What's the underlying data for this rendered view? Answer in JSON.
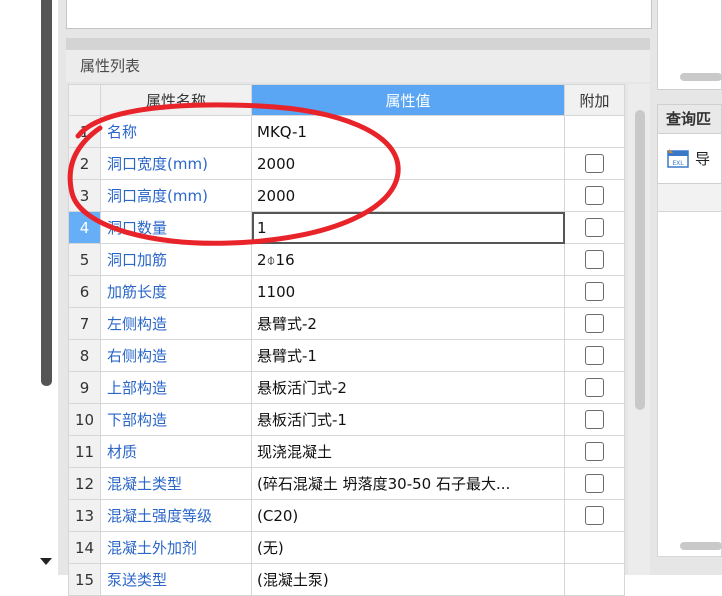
{
  "panel": {
    "title": "属性列表",
    "columns": {
      "index": "",
      "name": "属性名称",
      "value": "属性值",
      "extra": "附加"
    }
  },
  "rows": [
    {
      "index": "1",
      "name": "名称",
      "value": "MKQ-1",
      "has_checkbox": false
    },
    {
      "index": "2",
      "name": "洞口宽度(mm)",
      "value": "2000",
      "has_checkbox": true
    },
    {
      "index": "3",
      "name": "洞口高度(mm)",
      "value": "2000",
      "has_checkbox": true
    },
    {
      "index": "4",
      "name": "洞口数量",
      "value": "1",
      "has_checkbox": true,
      "selected": true
    },
    {
      "index": "5",
      "name": "洞口加筋",
      "value": "2⌽16",
      "has_checkbox": true
    },
    {
      "index": "6",
      "name": "加筋长度",
      "value": "1100",
      "has_checkbox": true
    },
    {
      "index": "7",
      "name": "左侧构造",
      "value": "悬臂式-2",
      "has_checkbox": true
    },
    {
      "index": "8",
      "name": "右侧构造",
      "value": "悬臂式-1",
      "has_checkbox": true
    },
    {
      "index": "9",
      "name": "上部构造",
      "value": "悬板活门式-2",
      "has_checkbox": true
    },
    {
      "index": "10",
      "name": "下部构造",
      "value": "悬板活门式-1",
      "has_checkbox": true
    },
    {
      "index": "11",
      "name": "材质",
      "value": "现浇混凝土",
      "has_checkbox": true
    },
    {
      "index": "12",
      "name": "混凝土类型",
      "value": "(碎石混凝土 坍落度30-50 石子最大...",
      "has_checkbox": true
    },
    {
      "index": "13",
      "name": "混凝土强度等级",
      "value": "(C20)",
      "has_checkbox": true
    },
    {
      "index": "14",
      "name": "混凝土外加剂",
      "value": "(无)",
      "has_checkbox": false
    },
    {
      "index": "15",
      "name": "泵送类型",
      "value": "(混凝土泵)",
      "has_checkbox": false
    }
  ],
  "right_panel": {
    "title": "查询匹",
    "import_label": "导",
    "excel_icon": "excel-import-icon"
  },
  "colors": {
    "header_value_bg": "#5aa6f4",
    "name_text": "#2b67c9",
    "annotation": "#e8232a"
  }
}
